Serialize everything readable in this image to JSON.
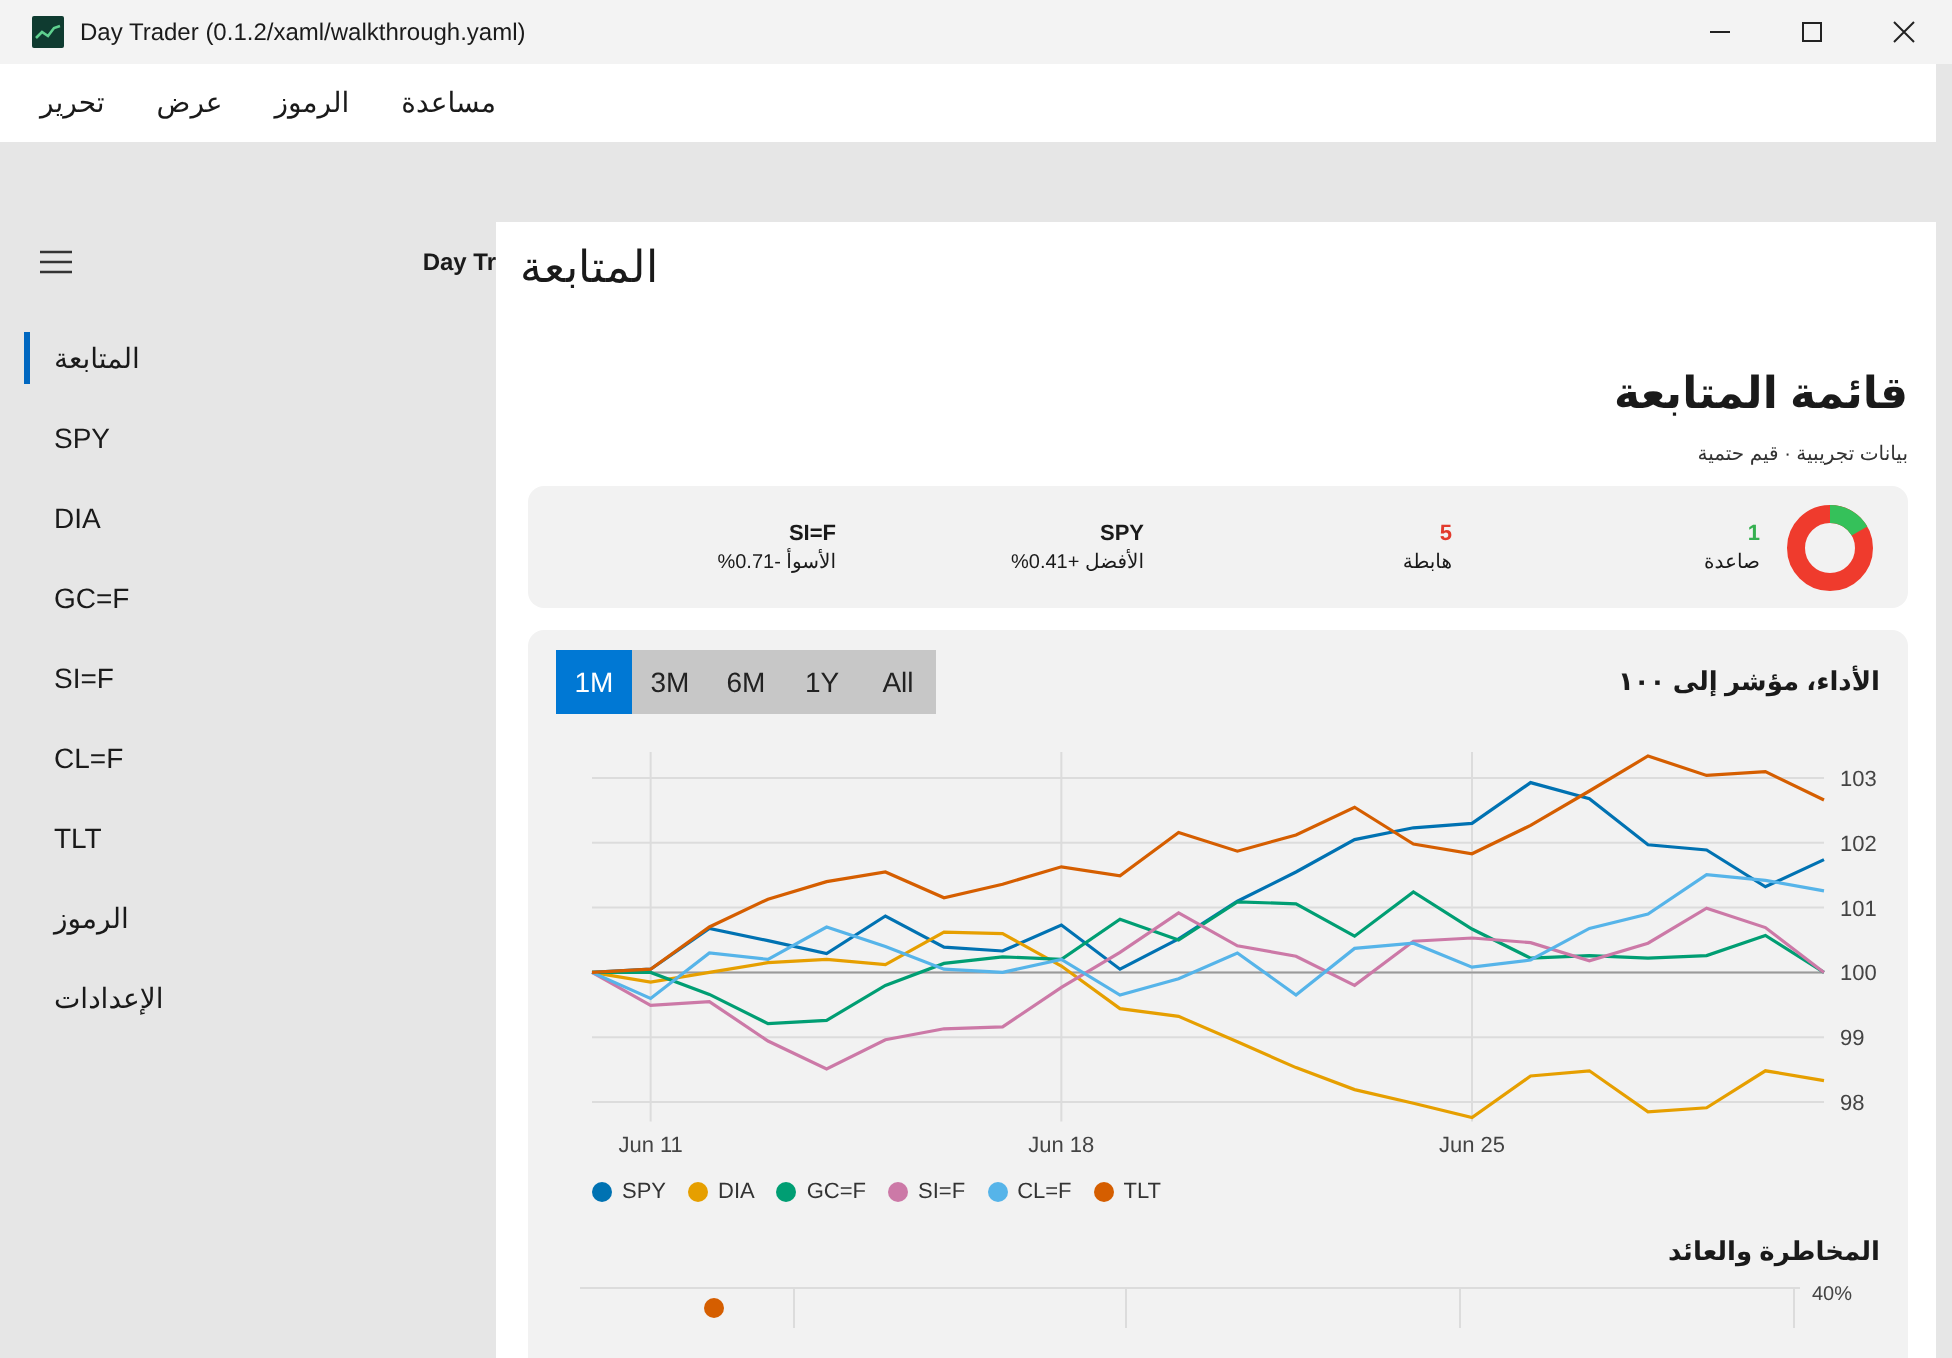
{
  "window": {
    "title": "Day Trader (0.1.2/xaml/walkthrough.yaml)"
  },
  "menu": [
    "مساعدة",
    "الرموز",
    "عرض",
    "تحرير"
  ],
  "nav": {
    "header": "Day Tr",
    "items": [
      {
        "label": "المتابعة",
        "selected": true
      },
      {
        "label": "SPY",
        "selected": false
      },
      {
        "label": "DIA",
        "selected": false
      },
      {
        "label": "GC=F",
        "selected": false
      },
      {
        "label": "SI=F",
        "selected": false
      },
      {
        "label": "CL=F",
        "selected": false
      },
      {
        "label": "TLT",
        "selected": false
      },
      {
        "label": "الرموز",
        "selected": false
      },
      {
        "label": "الإعدادات",
        "selected": false
      }
    ]
  },
  "page": {
    "title": "المتابعة",
    "heading": "قائمة المتابعة",
    "subtitle": "بيانات تجريبية · قيم حتمية"
  },
  "summary": {
    "up": {
      "value": "1",
      "label": "صاعدة"
    },
    "down": {
      "value": "5",
      "label": "هابطة"
    },
    "best": {
      "symbol": "SPY",
      "label": "الأفضل +0.41%"
    },
    "worst": {
      "symbol": "SI=F",
      "label": "الأسوأ -0.71%"
    }
  },
  "performance": {
    "title": "الأداء، مؤشر إلى ١٠٠",
    "ranges": [
      {
        "label": "All",
        "selected": false
      },
      {
        "label": "1Y",
        "selected": false
      },
      {
        "label": "6M",
        "selected": false
      },
      {
        "label": "3M",
        "selected": false
      },
      {
        "label": "1M",
        "selected": true
      }
    ],
    "chart_data": {
      "type": "line",
      "categories": [
        null,
        "Jun 11",
        null,
        null,
        null,
        null,
        null,
        null,
        "Jun 18",
        null,
        null,
        null,
        null,
        null,
        null,
        "Jun 25",
        null,
        null,
        null,
        null,
        null,
        null
      ],
      "ylim": [
        97.7,
        103.4
      ],
      "grid": true,
      "ref_lines": [
        {
          "axis": "y",
          "value": 100
        }
      ],
      "yticks": [
        98,
        99,
        100,
        101,
        102,
        103
      ],
      "series": [
        {
          "name": "SPY",
          "color": "#0072b2",
          "values": [
            100,
            100.05,
            100.68,
            100.49,
            100.29,
            100.87,
            100.39,
            100.33,
            100.73,
            100.05,
            100.52,
            101.1,
            101.55,
            102.05,
            102.23,
            102.3,
            102.93,
            102.68,
            101.97,
            101.89,
            101.32,
            101.74
          ]
        },
        {
          "name": "DIA",
          "color": "#e69f00",
          "values": [
            100,
            99.85,
            100,
            100.15,
            100.2,
            100.12,
            100.62,
            100.6,
            100.1,
            99.44,
            99.32,
            98.93,
            98.53,
            98.19,
            97.98,
            97.76,
            98.4,
            98.48,
            97.85,
            97.91,
            98.48,
            98.33
          ]
        },
        {
          "name": "GC=F",
          "color": "#009e73",
          "values": [
            100,
            100,
            99.66,
            99.21,
            99.26,
            99.8,
            100.14,
            100.24,
            100.2,
            100.82,
            100.5,
            101.09,
            101.06,
            100.56,
            101.24,
            100.67,
            100.22,
            100.26,
            100.22,
            100.26,
            100.57,
            100
          ]
        },
        {
          "name": "SI=F",
          "color": "#cc79a7",
          "values": [
            100,
            99.49,
            99.55,
            98.94,
            98.51,
            98.96,
            99.13,
            99.16,
            99.77,
            100.31,
            100.92,
            100.41,
            100.25,
            99.8,
            100.48,
            100.53,
            100.46,
            100.18,
            100.45,
            100.99,
            100.69,
            100
          ]
        },
        {
          "name": "CL=F",
          "color": "#56b4e9",
          "values": [
            100,
            99.6,
            100.3,
            100.2,
            100.7,
            100.4,
            100.05,
            100,
            100.2,
            99.65,
            99.9,
            100.3,
            99.65,
            100.37,
            100.45,
            100.08,
            100.19,
            100.68,
            100.9,
            101.51,
            101.42,
            101.26
          ]
        },
        {
          "name": "TLT",
          "color": "#d55e00",
          "values": [
            100,
            100.05,
            100.7,
            101.13,
            101.4,
            101.55,
            101.15,
            101.36,
            101.63,
            101.49,
            102.16,
            101.87,
            102.12,
            102.55,
            101.98,
            101.83,
            102.27,
            102.8,
            103.34,
            103.04,
            103.1,
            102.66
          ]
        }
      ]
    }
  },
  "risk_return": {
    "title": "المخاطرة والعائد",
    "tick_label": "40%"
  }
}
